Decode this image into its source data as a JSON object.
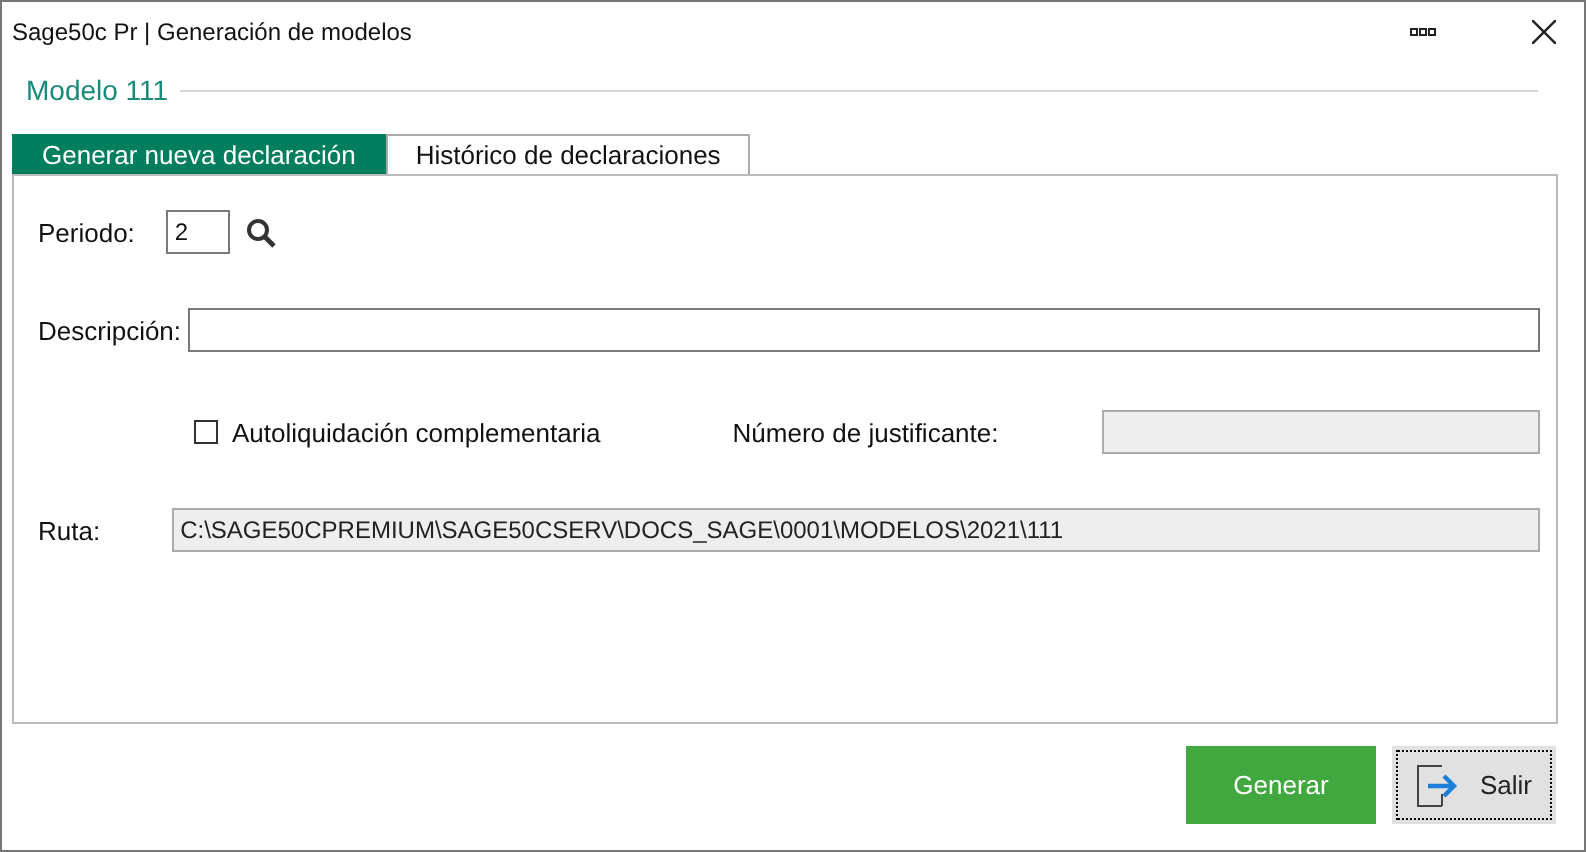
{
  "window": {
    "title": "Sage50c Pr | Generación de modelos"
  },
  "section_title": "Modelo 111",
  "tabs": [
    {
      "label": "Generar nueva declaración",
      "selected": true
    },
    {
      "label": "Histórico de declaraciones",
      "selected": false
    }
  ],
  "form": {
    "periodo": {
      "label": "Periodo:",
      "value": "2"
    },
    "descripcion": {
      "label": "Descripción:"
    },
    "autoliquidacion": {
      "label": "Autoliquidación complementaria",
      "checked": false
    },
    "justificante": {
      "label": "Número de justificante:",
      "disabled": true
    },
    "ruta": {
      "label": "Ruta:",
      "value": "C:\\SAGE50CPREMIUM\\SAGE50CSERV\\DOCS_SAGE\\0001\\MODELOS\\2021\\111",
      "disabled": true
    }
  },
  "buttons": [
    {
      "label": "Generar",
      "kind": "primary"
    },
    {
      "label": "Salir",
      "kind": "exit"
    }
  ]
}
